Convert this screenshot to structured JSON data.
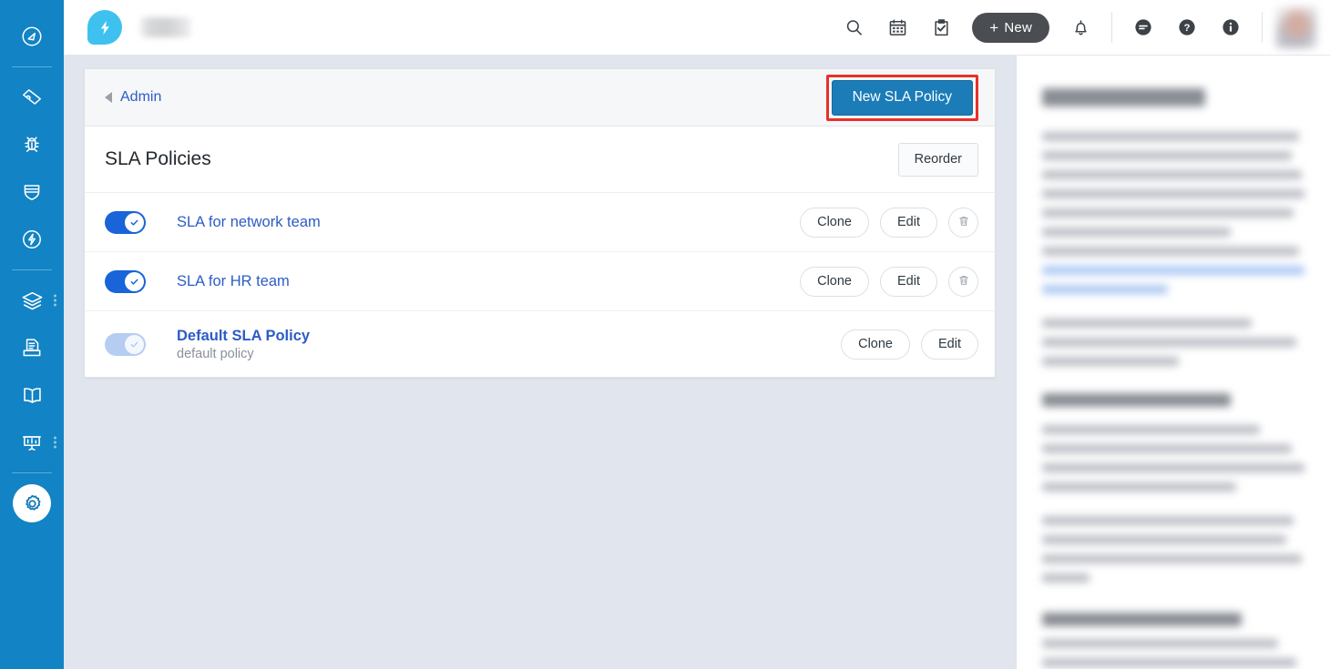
{
  "left_nav": {
    "items": [
      {
        "name": "dashboard-icon",
        "label": "Dashboard",
        "active": false
      },
      {
        "name": "ticket-icon",
        "label": "Tickets",
        "active": false
      },
      {
        "name": "bug-icon",
        "label": "Problems",
        "active": false
      },
      {
        "name": "shield-icon",
        "label": "Changes",
        "active": false
      },
      {
        "name": "release-icon",
        "label": "Releases",
        "active": false
      },
      {
        "name": "assets-icon",
        "label": "Assets",
        "active": false
      },
      {
        "name": "purchase-order-icon",
        "label": "Purchase Orders",
        "active": false
      },
      {
        "name": "solutions-icon",
        "label": "Solutions",
        "active": false
      },
      {
        "name": "analytics-icon",
        "label": "Analytics",
        "active": false
      },
      {
        "name": "gear-icon",
        "label": "Admin",
        "active": true
      }
    ]
  },
  "topbar": {
    "logo_name": "freshservice-logo",
    "new_button": {
      "label": "New",
      "plus": "+"
    },
    "icons": [
      {
        "name": "search-icon",
        "label": "Search"
      },
      {
        "name": "calendar-icon",
        "label": "Calendar"
      },
      {
        "name": "tasks-icon",
        "label": "Tasks"
      },
      {
        "name": "notifications-bell-icon",
        "label": "Notifications"
      },
      {
        "name": "feedback-icon",
        "label": "Feedback"
      },
      {
        "name": "help-icon",
        "label": "Help"
      },
      {
        "name": "info-icon",
        "label": "Info"
      }
    ],
    "avatar_name": "user-avatar"
  },
  "breadcrumb": {
    "back_caret": "back-caret-icon",
    "label": "Admin"
  },
  "primary_action": {
    "label": "New SLA Policy",
    "highlight_color": "#e8312a",
    "button_color": "#1b7cb8"
  },
  "section": {
    "title": "SLA Policies",
    "reorder_label": "Reorder"
  },
  "policies": [
    {
      "name": "SLA for network team",
      "description": "",
      "enabled": true,
      "toggle_state": "on",
      "actions": {
        "clone": "Clone",
        "edit": "Edit",
        "delete": "delete-icon"
      },
      "has_delete": true
    },
    {
      "name": "SLA for HR team",
      "description": "",
      "enabled": true,
      "toggle_state": "on",
      "actions": {
        "clone": "Clone",
        "edit": "Edit",
        "delete": "delete-icon"
      },
      "has_delete": true
    },
    {
      "name": "Default SLA Policy",
      "description": "default policy",
      "enabled": true,
      "toggle_state": "on-disabled",
      "actions": {
        "clone": "Clone",
        "edit": "Edit",
        "delete": ""
      },
      "has_delete": false
    }
  ],
  "doc_panel": {
    "name": "help-documentation-panel",
    "blurred": true,
    "note": "Blurred help article text"
  },
  "colors": {
    "nav_blue": "#1283c4",
    "link_blue": "#2c5cc5",
    "toggle_blue": "#1864d8",
    "page_bg": "#e1e5ed"
  }
}
